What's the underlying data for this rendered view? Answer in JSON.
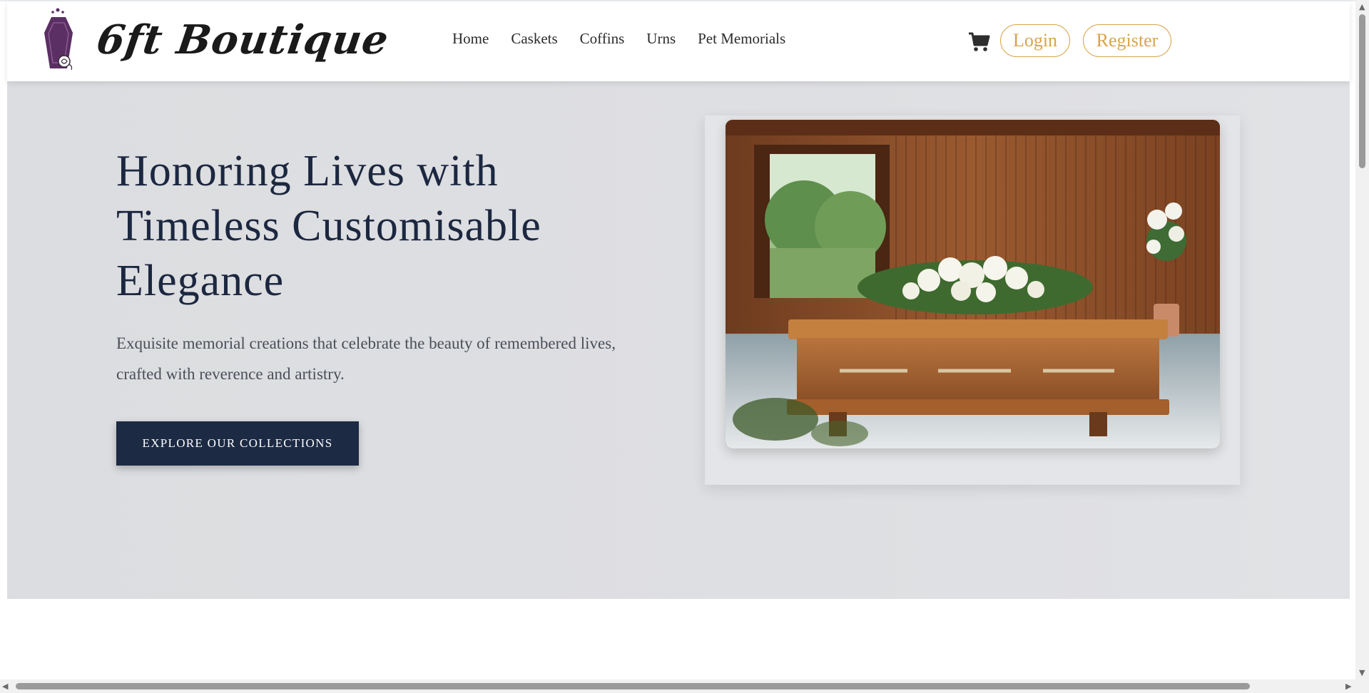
{
  "brand": {
    "name": "6ft Boutique",
    "logo_icon": "coffin-rose-logo-icon"
  },
  "nav": {
    "items": [
      {
        "label": "Home"
      },
      {
        "label": "Caskets"
      },
      {
        "label": "Coffins"
      },
      {
        "label": "Urns"
      },
      {
        "label": "Pet Memorials"
      }
    ]
  },
  "header_actions": {
    "cart_icon": "cart-icon",
    "login_label": "Login",
    "register_label": "Register"
  },
  "hero": {
    "title": "Honoring Lives with Timeless Customisable Elegance",
    "subtitle": "Exquisite memorial creations that celebrate the beauty of remembered lives, crafted with reverence and artistry.",
    "cta_label": "EXPLORE OUR COLLECTIONS",
    "image_alt": "wooden casket with white floral arrangement"
  },
  "colors": {
    "accent": "#d9a34b",
    "navy": "#1c2a44",
    "title": "#1c2740",
    "hero_bg": "#dcdde0",
    "logo_purple": "#5b2f63"
  }
}
